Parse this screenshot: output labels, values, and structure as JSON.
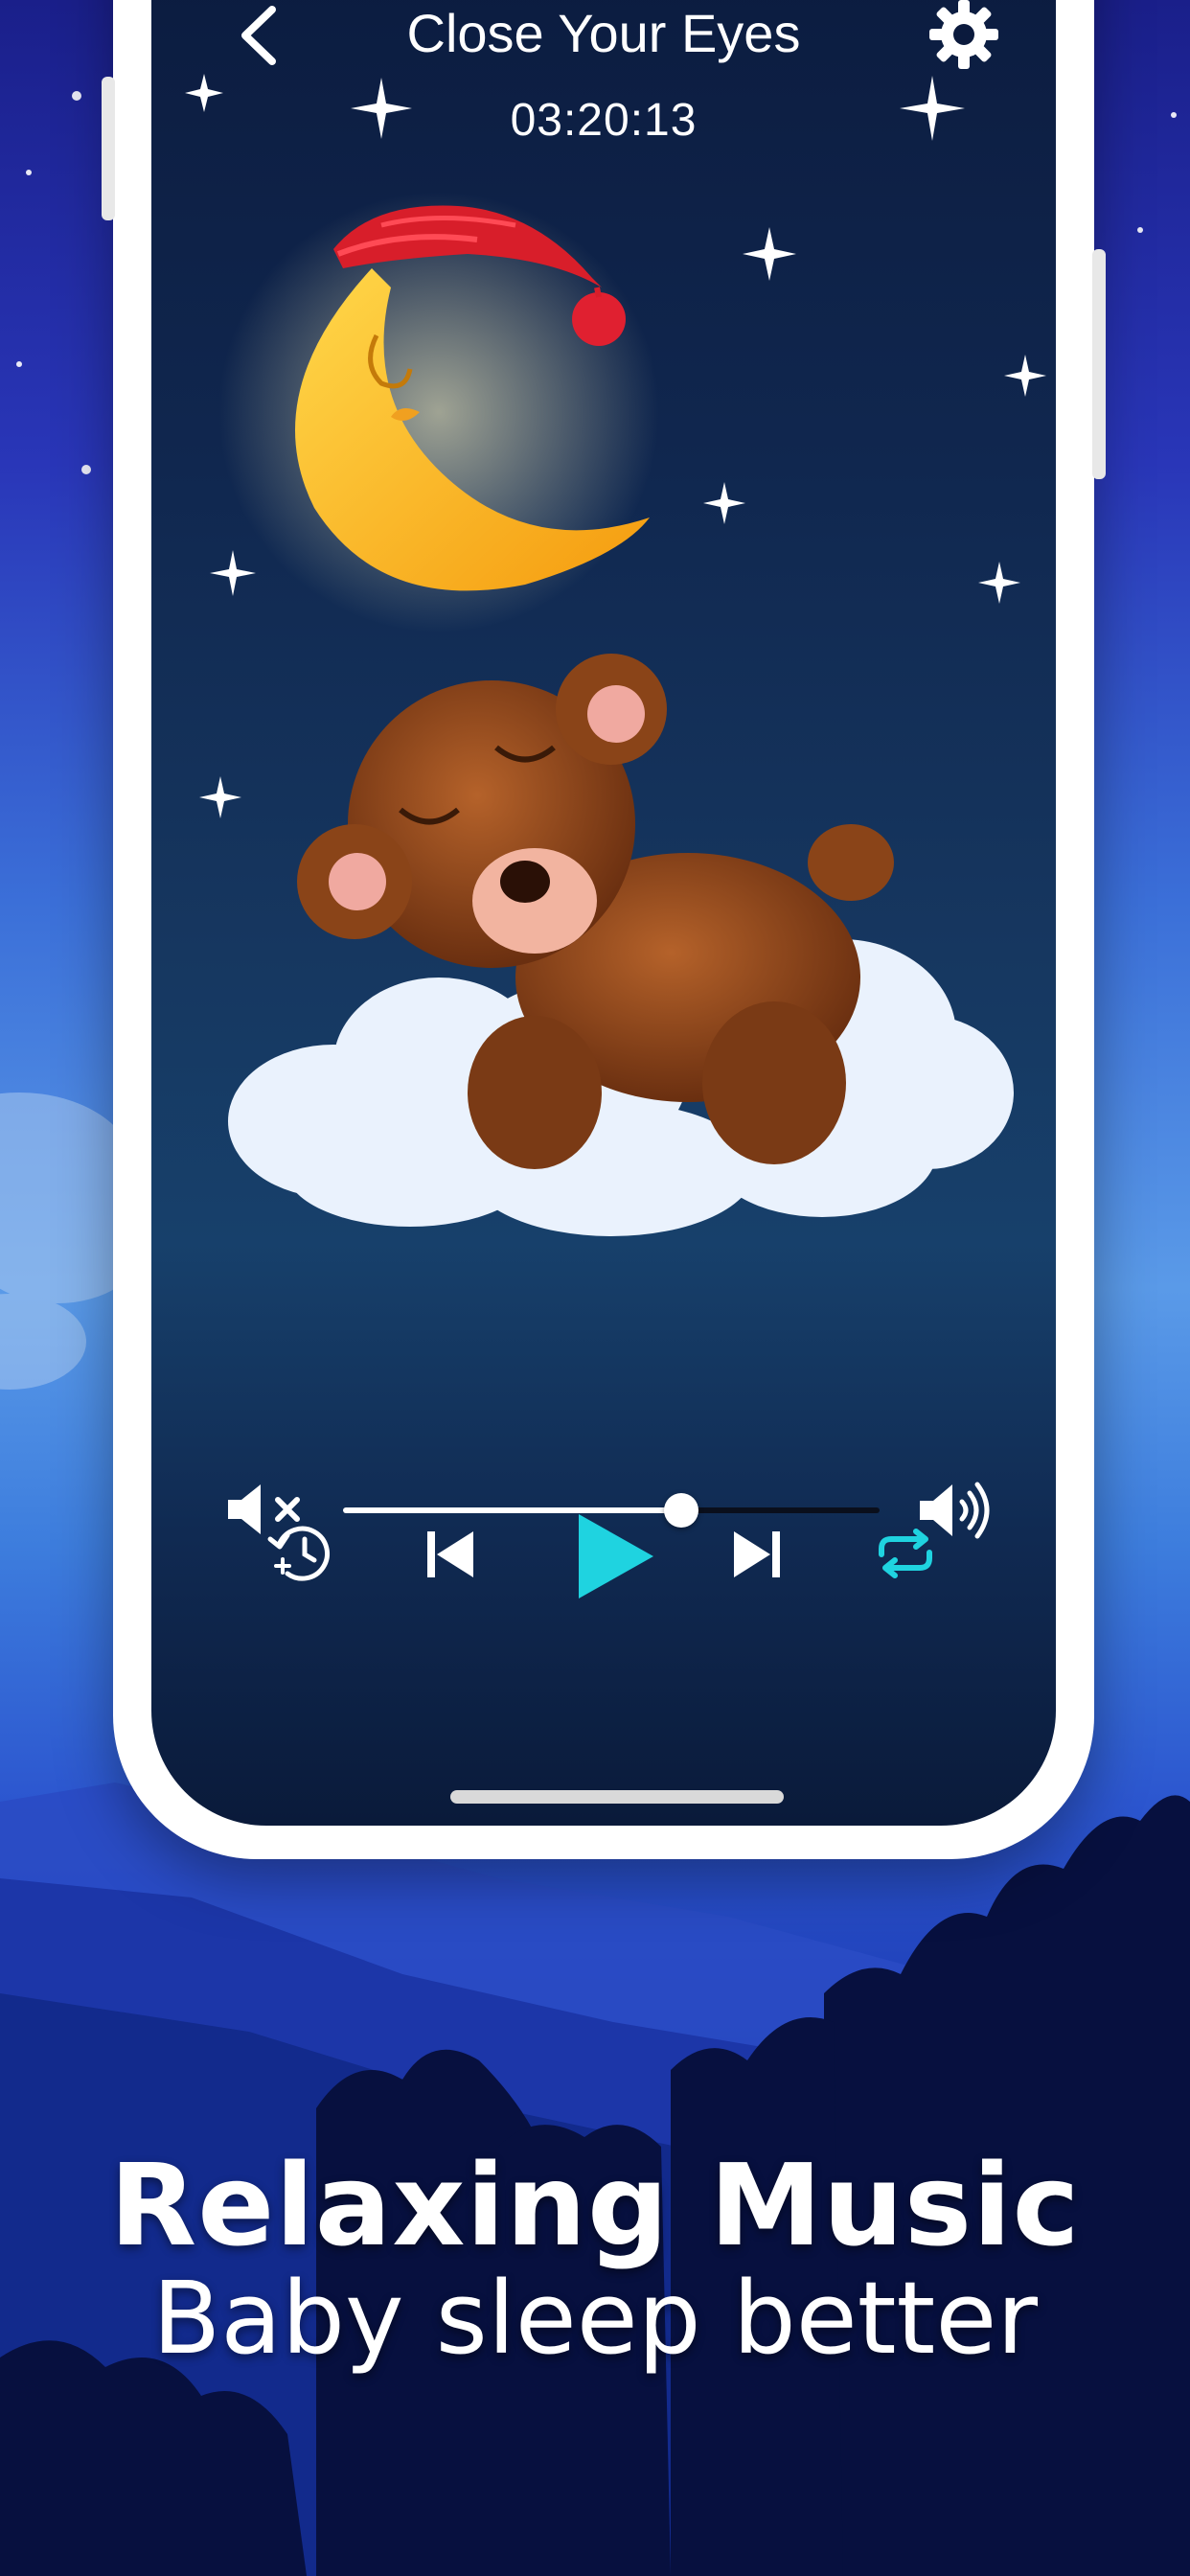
{
  "player": {
    "title": "Close Your Eyes",
    "timer": "03:20:13",
    "volume_level_percent": 63,
    "repeat_active": true,
    "accent_color": "#1fd3e0"
  },
  "icons": {
    "back": "chevron-left-icon",
    "settings": "gear-icon",
    "mute": "volume-mute-icon",
    "max": "volume-max-icon",
    "timer": "sleep-timer-icon",
    "previous": "skip-previous-icon",
    "play": "play-icon",
    "next": "skip-next-icon",
    "repeat": "repeat-icon"
  },
  "artwork": {
    "subject": "sleeping-moon-and-bear-on-cloud"
  },
  "caption": {
    "title": "Relaxing Music",
    "subtitle": "Baby sleep better"
  }
}
